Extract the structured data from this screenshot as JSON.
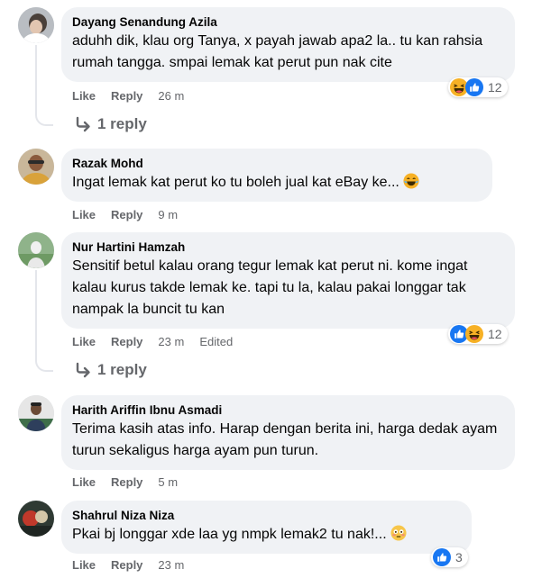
{
  "comments": [
    {
      "author": "Dayang Senandung Azila",
      "text": "aduhh dik, klau org Tanya, x payah jawab apa2 la.. tu kan rahsia rumah tangga. smpai lemak kat perut pun nak cite",
      "like": "Like",
      "reply": "Reply",
      "time": "26 m",
      "reaction_count": "12",
      "reactions": [
        "haha-icon",
        "like-icon"
      ],
      "replies_label": "1 reply"
    },
    {
      "author": "Razak Mohd",
      "text": "Ingat lemak kat perut ko tu boleh jual kat eBay ke...",
      "inline_emoji": "laughing-tears-emoji",
      "like": "Like",
      "reply": "Reply",
      "time": "9 m"
    },
    {
      "author": "Nur Hartini Hamzah",
      "text": "Sensitif betul kalau orang tegur lemak kat perut ni. kome ingat kalau kurus takde lemak ke. tapi tu la, kalau pakai longgar tak nampak la buncit tu kan",
      "like": "Like",
      "reply": "Reply",
      "time": "23 m",
      "edited": "Edited",
      "reaction_count": "12",
      "reactions": [
        "like-icon",
        "haha-icon"
      ],
      "replies_label": "1 reply"
    },
    {
      "author": "Harith Ariffin Ibnu Asmadi",
      "text": "Terima kasih atas info. Harap dengan berita ini, harga dedak ayam turun sekaligus harga ayam pun turun.",
      "like": "Like",
      "reply": "Reply",
      "time": "5 m"
    },
    {
      "author": "Shahrul Niza Niza",
      "text": "Pkai bj longgar xde laa yg nmpk lemak2 tu nak!...",
      "inline_emoji": "flushed-emoji",
      "like": "Like",
      "reply": "Reply",
      "time": "23 m",
      "reaction_count": "3",
      "reactions": [
        "like-icon"
      ]
    }
  ],
  "colors": {
    "bubble": "#f0f2f5",
    "meta": "#65676b",
    "like_blue": "#1877f2",
    "haha_yellow": "#f7b125"
  }
}
